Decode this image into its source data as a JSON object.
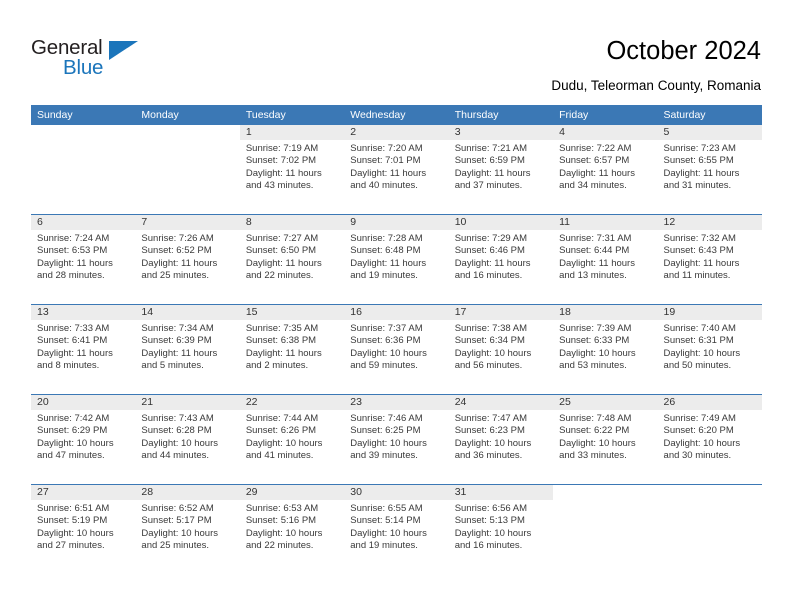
{
  "brand": {
    "name_top": "General",
    "name_bottom": "Blue",
    "color_dark": "#231f20",
    "color_blue": "#1b75bb",
    "triangle_icon": "triangle-icon"
  },
  "header": {
    "title": "October 2024",
    "subtitle": "Dudu, Teleorman County, Romania"
  },
  "theme": {
    "header_bg": "#3b78b5",
    "header_text": "#ffffff",
    "daynum_band_bg": "#ececec",
    "row_divider": "#3b78b5"
  },
  "calendar": {
    "weekday_headers": [
      "Sunday",
      "Monday",
      "Tuesday",
      "Wednesday",
      "Thursday",
      "Friday",
      "Saturday"
    ],
    "weeks": [
      [
        {
          "day": "",
          "sunrise": "",
          "sunset": "",
          "daylight_line1": "",
          "daylight_line2": ""
        },
        {
          "day": "",
          "sunrise": "",
          "sunset": "",
          "daylight_line1": "",
          "daylight_line2": ""
        },
        {
          "day": "1",
          "sunrise": "Sunrise: 7:19 AM",
          "sunset": "Sunset: 7:02 PM",
          "daylight_line1": "Daylight: 11 hours",
          "daylight_line2": "and 43 minutes."
        },
        {
          "day": "2",
          "sunrise": "Sunrise: 7:20 AM",
          "sunset": "Sunset: 7:01 PM",
          "daylight_line1": "Daylight: 11 hours",
          "daylight_line2": "and 40 minutes."
        },
        {
          "day": "3",
          "sunrise": "Sunrise: 7:21 AM",
          "sunset": "Sunset: 6:59 PM",
          "daylight_line1": "Daylight: 11 hours",
          "daylight_line2": "and 37 minutes."
        },
        {
          "day": "4",
          "sunrise": "Sunrise: 7:22 AM",
          "sunset": "Sunset: 6:57 PM",
          "daylight_line1": "Daylight: 11 hours",
          "daylight_line2": "and 34 minutes."
        },
        {
          "day": "5",
          "sunrise": "Sunrise: 7:23 AM",
          "sunset": "Sunset: 6:55 PM",
          "daylight_line1": "Daylight: 11 hours",
          "daylight_line2": "and 31 minutes."
        }
      ],
      [
        {
          "day": "6",
          "sunrise": "Sunrise: 7:24 AM",
          "sunset": "Sunset: 6:53 PM",
          "daylight_line1": "Daylight: 11 hours",
          "daylight_line2": "and 28 minutes."
        },
        {
          "day": "7",
          "sunrise": "Sunrise: 7:26 AM",
          "sunset": "Sunset: 6:52 PM",
          "daylight_line1": "Daylight: 11 hours",
          "daylight_line2": "and 25 minutes."
        },
        {
          "day": "8",
          "sunrise": "Sunrise: 7:27 AM",
          "sunset": "Sunset: 6:50 PM",
          "daylight_line1": "Daylight: 11 hours",
          "daylight_line2": "and 22 minutes."
        },
        {
          "day": "9",
          "sunrise": "Sunrise: 7:28 AM",
          "sunset": "Sunset: 6:48 PM",
          "daylight_line1": "Daylight: 11 hours",
          "daylight_line2": "and 19 minutes."
        },
        {
          "day": "10",
          "sunrise": "Sunrise: 7:29 AM",
          "sunset": "Sunset: 6:46 PM",
          "daylight_line1": "Daylight: 11 hours",
          "daylight_line2": "and 16 minutes."
        },
        {
          "day": "11",
          "sunrise": "Sunrise: 7:31 AM",
          "sunset": "Sunset: 6:44 PM",
          "daylight_line1": "Daylight: 11 hours",
          "daylight_line2": "and 13 minutes."
        },
        {
          "day": "12",
          "sunrise": "Sunrise: 7:32 AM",
          "sunset": "Sunset: 6:43 PM",
          "daylight_line1": "Daylight: 11 hours",
          "daylight_line2": "and 11 minutes."
        }
      ],
      [
        {
          "day": "13",
          "sunrise": "Sunrise: 7:33 AM",
          "sunset": "Sunset: 6:41 PM",
          "daylight_line1": "Daylight: 11 hours",
          "daylight_line2": "and 8 minutes."
        },
        {
          "day": "14",
          "sunrise": "Sunrise: 7:34 AM",
          "sunset": "Sunset: 6:39 PM",
          "daylight_line1": "Daylight: 11 hours",
          "daylight_line2": "and 5 minutes."
        },
        {
          "day": "15",
          "sunrise": "Sunrise: 7:35 AM",
          "sunset": "Sunset: 6:38 PM",
          "daylight_line1": "Daylight: 11 hours",
          "daylight_line2": "and 2 minutes."
        },
        {
          "day": "16",
          "sunrise": "Sunrise: 7:37 AM",
          "sunset": "Sunset: 6:36 PM",
          "daylight_line1": "Daylight: 10 hours",
          "daylight_line2": "and 59 minutes."
        },
        {
          "day": "17",
          "sunrise": "Sunrise: 7:38 AM",
          "sunset": "Sunset: 6:34 PM",
          "daylight_line1": "Daylight: 10 hours",
          "daylight_line2": "and 56 minutes."
        },
        {
          "day": "18",
          "sunrise": "Sunrise: 7:39 AM",
          "sunset": "Sunset: 6:33 PM",
          "daylight_line1": "Daylight: 10 hours",
          "daylight_line2": "and 53 minutes."
        },
        {
          "day": "19",
          "sunrise": "Sunrise: 7:40 AM",
          "sunset": "Sunset: 6:31 PM",
          "daylight_line1": "Daylight: 10 hours",
          "daylight_line2": "and 50 minutes."
        }
      ],
      [
        {
          "day": "20",
          "sunrise": "Sunrise: 7:42 AM",
          "sunset": "Sunset: 6:29 PM",
          "daylight_line1": "Daylight: 10 hours",
          "daylight_line2": "and 47 minutes."
        },
        {
          "day": "21",
          "sunrise": "Sunrise: 7:43 AM",
          "sunset": "Sunset: 6:28 PM",
          "daylight_line1": "Daylight: 10 hours",
          "daylight_line2": "and 44 minutes."
        },
        {
          "day": "22",
          "sunrise": "Sunrise: 7:44 AM",
          "sunset": "Sunset: 6:26 PM",
          "daylight_line1": "Daylight: 10 hours",
          "daylight_line2": "and 41 minutes."
        },
        {
          "day": "23",
          "sunrise": "Sunrise: 7:46 AM",
          "sunset": "Sunset: 6:25 PM",
          "daylight_line1": "Daylight: 10 hours",
          "daylight_line2": "and 39 minutes."
        },
        {
          "day": "24",
          "sunrise": "Sunrise: 7:47 AM",
          "sunset": "Sunset: 6:23 PM",
          "daylight_line1": "Daylight: 10 hours",
          "daylight_line2": "and 36 minutes."
        },
        {
          "day": "25",
          "sunrise": "Sunrise: 7:48 AM",
          "sunset": "Sunset: 6:22 PM",
          "daylight_line1": "Daylight: 10 hours",
          "daylight_line2": "and 33 minutes."
        },
        {
          "day": "26",
          "sunrise": "Sunrise: 7:49 AM",
          "sunset": "Sunset: 6:20 PM",
          "daylight_line1": "Daylight: 10 hours",
          "daylight_line2": "and 30 minutes."
        }
      ],
      [
        {
          "day": "27",
          "sunrise": "Sunrise: 6:51 AM",
          "sunset": "Sunset: 5:19 PM",
          "daylight_line1": "Daylight: 10 hours",
          "daylight_line2": "and 27 minutes."
        },
        {
          "day": "28",
          "sunrise": "Sunrise: 6:52 AM",
          "sunset": "Sunset: 5:17 PM",
          "daylight_line1": "Daylight: 10 hours",
          "daylight_line2": "and 25 minutes."
        },
        {
          "day": "29",
          "sunrise": "Sunrise: 6:53 AM",
          "sunset": "Sunset: 5:16 PM",
          "daylight_line1": "Daylight: 10 hours",
          "daylight_line2": "and 22 minutes."
        },
        {
          "day": "30",
          "sunrise": "Sunrise: 6:55 AM",
          "sunset": "Sunset: 5:14 PM",
          "daylight_line1": "Daylight: 10 hours",
          "daylight_line2": "and 19 minutes."
        },
        {
          "day": "31",
          "sunrise": "Sunrise: 6:56 AM",
          "sunset": "Sunset: 5:13 PM",
          "daylight_line1": "Daylight: 10 hours",
          "daylight_line2": "and 16 minutes."
        },
        {
          "day": "",
          "sunrise": "",
          "sunset": "",
          "daylight_line1": "",
          "daylight_line2": ""
        },
        {
          "day": "",
          "sunrise": "",
          "sunset": "",
          "daylight_line1": "",
          "daylight_line2": ""
        }
      ]
    ]
  }
}
